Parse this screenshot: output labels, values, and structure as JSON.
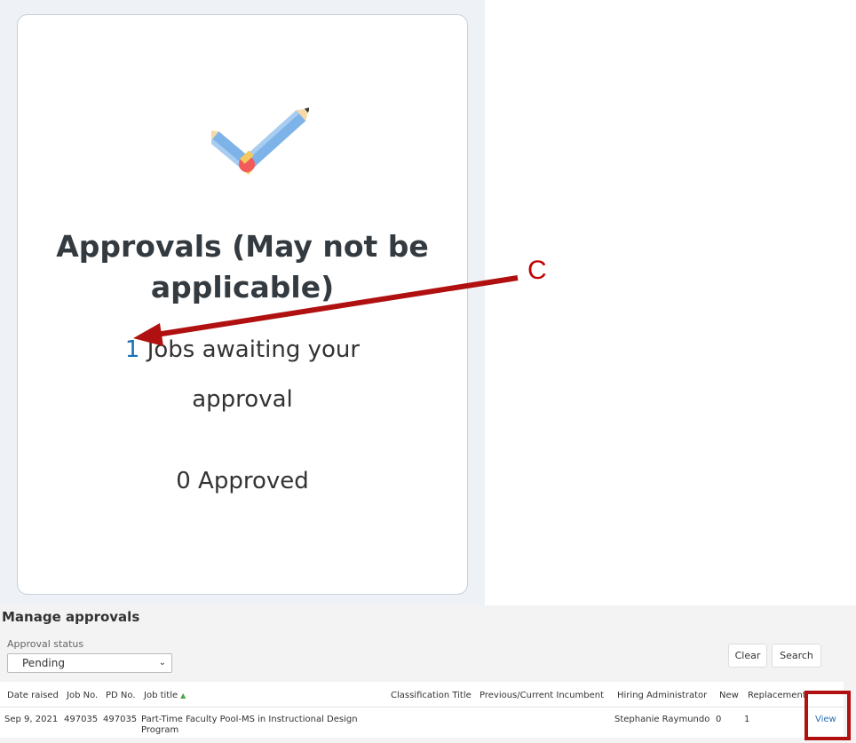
{
  "card": {
    "title_line1": "Approvals (May not be",
    "title_line2": "applicable)",
    "awaiting_count": "1",
    "awaiting_text_line1": "Jobs awaiting your",
    "awaiting_text_line2": "approval",
    "approved_count": "0",
    "approved_text": "Approved",
    "icon": "pencil-checkmark-icon"
  },
  "annotation": {
    "label": "C"
  },
  "manage": {
    "title": "Manage approvals",
    "status_label": "Approval status",
    "status_value": "Pending",
    "clear_label": "Clear",
    "search_label": "Search",
    "columns": [
      "Date raised",
      "Job No.",
      "PD No.",
      "Job title",
      "Classification Title",
      "Previous/Current Incumbent",
      "Hiring Administrator",
      "New",
      "Replacement"
    ],
    "row": {
      "date_raised": "Sep 9, 2021",
      "job_no": "497035",
      "pd_no": "497035",
      "job_title": "Part-Time Faculty Pool-MS in Instructional Design Program",
      "classification_title": "",
      "incumbent": "",
      "hiring_admin": "Stephanie Raymundo",
      "new": "0",
      "replacement": "1",
      "action": "View"
    }
  },
  "colors": {
    "accent_blue": "#1a6fb5",
    "annotation_red": "#c00000"
  }
}
